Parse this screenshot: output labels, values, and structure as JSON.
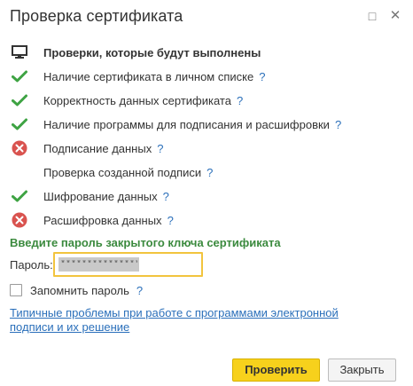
{
  "window": {
    "title": "Проверка сертификата",
    "maximize_symbol": "□",
    "close_symbol": "✕"
  },
  "checks": {
    "header": "Проверки, которые будут выполнены",
    "help_symbol": "?",
    "items": [
      {
        "label": "Наличие сертификата в личном списке",
        "status": "ok"
      },
      {
        "label": "Корректность данных сертификата",
        "status": "ok"
      },
      {
        "label": "Наличие программы для подписания и расшифровки",
        "status": "ok"
      },
      {
        "label": "Подписание данных",
        "status": "error"
      },
      {
        "label": "Проверка созданной подписи",
        "status": "none"
      },
      {
        "label": "Шифрование данных",
        "status": "ok"
      },
      {
        "label": "Расшифровка данных",
        "status": "error"
      }
    ]
  },
  "password_section": {
    "title": "Введите пароль закрытого ключа сертификата",
    "label": "Пароль:",
    "value": "***************",
    "remember_label": "Запомнить пароль",
    "remember_checked": false
  },
  "link": {
    "text": "Типичные проблемы при работе с программами электронной подписи и их решение"
  },
  "buttons": {
    "primary": "Проверить",
    "secondary": "Закрыть"
  },
  "colors": {
    "ok": "#3ea343",
    "error": "#d9534f",
    "link": "#2a6fba",
    "section_title": "#3b8a3e",
    "primary_button": "#f7d11c",
    "focus_border": "#f2c43e"
  }
}
